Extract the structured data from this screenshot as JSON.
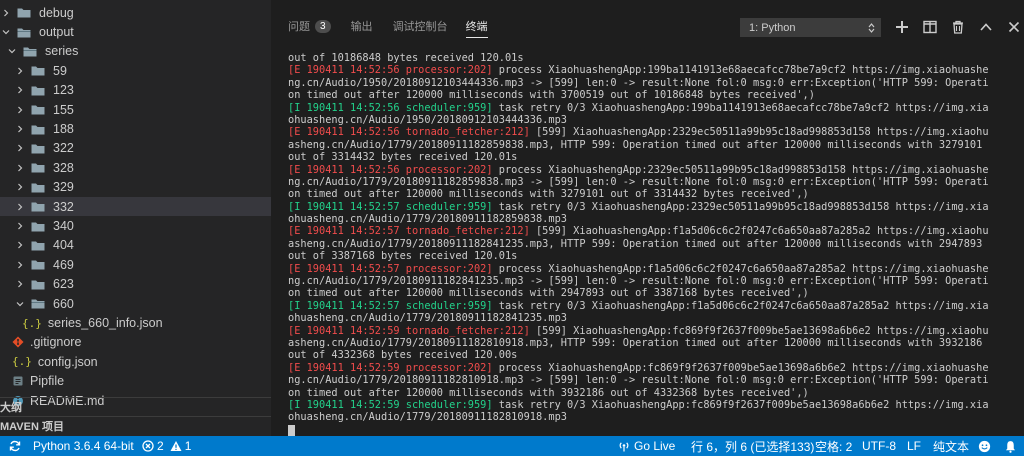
{
  "sidebar": {
    "rows": [
      {
        "label": "debug",
        "kind": "folder",
        "state": "collapsed"
      },
      {
        "label": "output",
        "kind": "folder",
        "state": "expanded"
      },
      {
        "label": "series",
        "kind": "folder",
        "state": "expanded"
      },
      {
        "label": "59",
        "kind": "folder",
        "state": "collapsed"
      },
      {
        "label": "123",
        "kind": "folder",
        "state": "collapsed"
      },
      {
        "label": "155",
        "kind": "folder",
        "state": "collapsed"
      },
      {
        "label": "188",
        "kind": "folder",
        "state": "collapsed"
      },
      {
        "label": "322",
        "kind": "folder",
        "state": "collapsed"
      },
      {
        "label": "328",
        "kind": "folder",
        "state": "collapsed"
      },
      {
        "label": "329",
        "kind": "folder",
        "state": "collapsed"
      },
      {
        "label": "332",
        "kind": "folder",
        "state": "collapsed",
        "selected": true
      },
      {
        "label": "340",
        "kind": "folder",
        "state": "collapsed"
      },
      {
        "label": "404",
        "kind": "folder",
        "state": "collapsed"
      },
      {
        "label": "469",
        "kind": "folder",
        "state": "collapsed"
      },
      {
        "label": "623",
        "kind": "folder",
        "state": "collapsed"
      },
      {
        "label": "660",
        "kind": "folder",
        "state": "expanded"
      },
      {
        "label": "series_660_info.json",
        "kind": "json"
      },
      {
        "label": ".gitignore",
        "kind": "git"
      },
      {
        "label": "config.json",
        "kind": "json"
      },
      {
        "label": "Pipfile",
        "kind": "pip"
      },
      {
        "label": "README.md",
        "kind": "md"
      }
    ],
    "outline_header": "大纲",
    "maven_header": "MAVEN 项目"
  },
  "panel": {
    "tabs": [
      {
        "label": "问题",
        "badge": "3"
      },
      {
        "label": "输出"
      },
      {
        "label": "调试控制台"
      },
      {
        "label": "终端",
        "active": true
      }
    ],
    "terminal_select": "1: Python",
    "icons": [
      "plus-icon",
      "split-icon",
      "trash-icon",
      "chevron-up-icon",
      "close-icon"
    ]
  },
  "terminal": {
    "lines": [
      {
        "parts": [
          {
            "t": "out of 10186848 bytes received 120.01s",
            "c": ""
          }
        ]
      },
      {
        "parts": [
          {
            "t": "[E 190411 14:52:56 processor:202]",
            "c": "err"
          },
          {
            "t": " process XiaohuashengApp:199ba1141913e68aecafcc78be7a9cf2 https://img.xiaohuashe",
            "c": ""
          }
        ]
      },
      {
        "parts": [
          {
            "t": "ng.cn/Audio/1950/20180912103444336.mp3 -> [599] len:0 -> result:None fol:0 msg:0 err:Exception('HTTP 599: Operati",
            "c": ""
          }
        ]
      },
      {
        "parts": [
          {
            "t": "on timed out after 120000 milliseconds with 3700519 out of 10186848 bytes received',)",
            "c": ""
          }
        ]
      },
      {
        "parts": [
          {
            "t": "[I 190411 14:52:56 scheduler:959]",
            "c": "info"
          },
          {
            "t": " task retry 0/3 XiaohuashengApp:199ba1141913e68aecafcc78be7a9cf2 https://img.xia",
            "c": ""
          }
        ]
      },
      {
        "parts": [
          {
            "t": "ohuasheng.cn/Audio/1950/20180912103444336.mp3",
            "c": ""
          }
        ]
      },
      {
        "parts": [
          {
            "t": "[E 190411 14:52:56 tornado_fetcher:212]",
            "c": "err"
          },
          {
            "t": " [599] XiaohuashengApp:2329ec50511a99b95c18ad998853d158 https://img.xiaohu",
            "c": ""
          }
        ]
      },
      {
        "parts": [
          {
            "t": "asheng.cn/Audio/1779/20180911182859838.mp3, HTTP 599: Operation timed out after 120000 milliseconds with 3279101",
            "c": ""
          }
        ]
      },
      {
        "parts": [
          {
            "t": "out of 3314432 bytes received 120.01s",
            "c": ""
          }
        ]
      },
      {
        "parts": [
          {
            "t": "[E 190411 14:52:56 processor:202]",
            "c": "err"
          },
          {
            "t": " process XiaohuashengApp:2329ec50511a99b95c18ad998853d158 https://img.xiaohuashe",
            "c": ""
          }
        ]
      },
      {
        "parts": [
          {
            "t": "ng.cn/Audio/1779/20180911182859838.mp3 -> [599] len:0 -> result:None fol:0 msg:0 err:Exception('HTTP 599: Operati",
            "c": ""
          }
        ]
      },
      {
        "parts": [
          {
            "t": "on timed out after 120000 milliseconds with 3279101 out of 3314432 bytes received',)",
            "c": ""
          }
        ]
      },
      {
        "parts": [
          {
            "t": "[I 190411 14:52:57 scheduler:959]",
            "c": "info"
          },
          {
            "t": " task retry 0/3 XiaohuashengApp:2329ec50511a99b95c18ad998853d158 https://img.xia",
            "c": ""
          }
        ]
      },
      {
        "parts": [
          {
            "t": "ohuasheng.cn/Audio/1779/20180911182859838.mp3",
            "c": ""
          }
        ]
      },
      {
        "parts": [
          {
            "t": "[E 190411 14:52:57 tornado_fetcher:212]",
            "c": "err"
          },
          {
            "t": " [599] XiaohuashengApp:f1a5d06c6c2f0247c6a650aa87a285a2 https://img.xiaohu",
            "c": ""
          }
        ]
      },
      {
        "parts": [
          {
            "t": "asheng.cn/Audio/1779/20180911182841235.mp3, HTTP 599: Operation timed out after 120000 milliseconds with 2947893",
            "c": ""
          }
        ]
      },
      {
        "parts": [
          {
            "t": "out of 3387168 bytes received 120.01s",
            "c": ""
          }
        ]
      },
      {
        "parts": [
          {
            "t": "[E 190411 14:52:57 processor:202]",
            "c": "err"
          },
          {
            "t": " process XiaohuashengApp:f1a5d06c6c2f0247c6a650aa87a285a2 https://img.xiaohuashe",
            "c": ""
          }
        ]
      },
      {
        "parts": [
          {
            "t": "ng.cn/Audio/1779/20180911182841235.mp3 -> [599] len:0 -> result:None fol:0 msg:0 err:Exception('HTTP 599: Operati",
            "c": ""
          }
        ]
      },
      {
        "parts": [
          {
            "t": "on timed out after 120000 milliseconds with 2947893 out of 3387168 bytes received',)",
            "c": ""
          }
        ]
      },
      {
        "parts": [
          {
            "t": "[I 190411 14:52:57 scheduler:959]",
            "c": "info"
          },
          {
            "t": " task retry 0/3 XiaohuashengApp:f1a5d06c6c2f0247c6a650aa87a285a2 https://img.xia",
            "c": ""
          }
        ]
      },
      {
        "parts": [
          {
            "t": "ohuasheng.cn/Audio/1779/20180911182841235.mp3",
            "c": ""
          }
        ]
      },
      {
        "parts": [
          {
            "t": "[E 190411 14:52:59 tornado_fetcher:212]",
            "c": "err"
          },
          {
            "t": " [599] XiaohuashengApp:fc869f9f2637f009be5ae13698a6b6e2 https://img.xiaohu",
            "c": ""
          }
        ]
      },
      {
        "parts": [
          {
            "t": "asheng.cn/Audio/1779/20180911182810918.mp3, HTTP 599: Operation timed out after 120000 milliseconds with 3932186",
            "c": ""
          }
        ]
      },
      {
        "parts": [
          {
            "t": "out of 4332368 bytes received 120.00s",
            "c": ""
          }
        ]
      },
      {
        "parts": [
          {
            "t": "[E 190411 14:52:59 processor:202]",
            "c": "err"
          },
          {
            "t": " process XiaohuashengApp:fc869f9f2637f009be5ae13698a6b6e2 https://img.xiaohuashe",
            "c": ""
          }
        ]
      },
      {
        "parts": [
          {
            "t": "ng.cn/Audio/1779/20180911182810918.mp3 -> [599] len:0 -> result:None fol:0 msg:0 err:Exception('HTTP 599: Operati",
            "c": ""
          }
        ]
      },
      {
        "parts": [
          {
            "t": "on timed out after 120000 milliseconds with 3932186 out of 4332368 bytes received',)",
            "c": ""
          }
        ]
      },
      {
        "parts": [
          {
            "t": "[I 190411 14:52:59 scheduler:959]",
            "c": "info"
          },
          {
            "t": " task retry 0/3 XiaohuashengApp:fc869f9f2637f009be5ae13698a6b6e2 https://img.xia",
            "c": ""
          }
        ]
      },
      {
        "parts": [
          {
            "t": "ohuasheng.cn/Audio/1779/20180911182810918.mp3",
            "c": ""
          }
        ]
      }
    ]
  },
  "statusbar": {
    "interpreter": "Python 3.6.4 64-bit",
    "errors": "2",
    "warnings": "1",
    "golive": "Go Live",
    "position": "行 6，列 6 (已选择133)",
    "spaces": "空格: 2",
    "encoding": "UTF-8",
    "eol": "LF",
    "language": "纯文本"
  },
  "colors": {
    "status_blue": "#007acc",
    "error_red": "#f14c4c",
    "info_green": "#23d18b",
    "folder_blue": "#90a4ae"
  }
}
